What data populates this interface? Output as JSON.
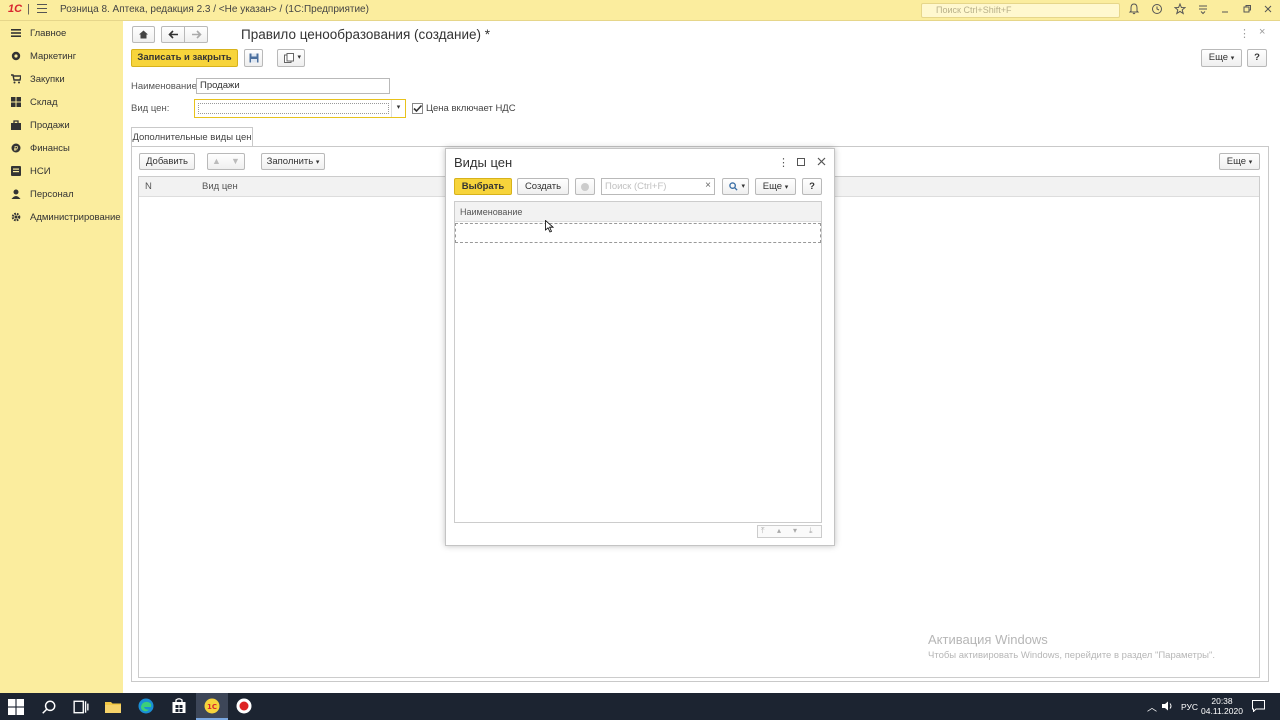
{
  "app": {
    "logo": "1С",
    "title": "Розница 8. Аптека, редакция 2.3 / <Не указан> /  (1С:Предприятие)",
    "search_placeholder": "Поиск Ctrl+Shift+F"
  },
  "sidebar": {
    "items": [
      {
        "label": "Главное",
        "icon": "menu-icon"
      },
      {
        "label": "Маркетинг",
        "icon": "marketing-icon"
      },
      {
        "label": "Закупки",
        "icon": "purchases-icon"
      },
      {
        "label": "Склад",
        "icon": "warehouse-icon"
      },
      {
        "label": "Продажи",
        "icon": "sales-icon"
      },
      {
        "label": "Финансы",
        "icon": "finance-icon"
      },
      {
        "label": "НСИ",
        "icon": "reference-icon"
      },
      {
        "label": "Персонал",
        "icon": "personnel-icon"
      },
      {
        "label": "Администрирование",
        "icon": "gear-icon"
      }
    ]
  },
  "form": {
    "title": "Правило ценообразования (создание) *",
    "save_close_label": "Записать и закрыть",
    "more_label": "Еще",
    "help_label": "?",
    "name_label": "Наименование:",
    "name_value": "Продажи",
    "price_type_label": "Вид цен:",
    "price_type_value": "",
    "vat_checkbox_label": "Цена включает НДС",
    "vat_checked": true,
    "tab_label": "Дополнительные виды цен",
    "add_label": "Добавить",
    "fill_label": "Заполнить",
    "table_more_label": "Еще",
    "columns": [
      "N",
      "Вид цен"
    ]
  },
  "dialog": {
    "title": "Виды цен",
    "select_label": "Выбрать",
    "create_label": "Создать",
    "search_placeholder": "Поиск (Ctrl+F)",
    "clear_label": "×",
    "more_label": "Еще",
    "help_label": "?",
    "column_header": "Наименование"
  },
  "watermark": {
    "title": "Активация Windows",
    "text": "Чтобы активировать Windows, перейдите в раздел \"Параметры\"."
  },
  "taskbar": {
    "lang": "РУС",
    "time": "20:38",
    "date": "04.11.2020"
  },
  "colors": {
    "accent_yellow": "#f7d43b",
    "panel_yellow": "#fbed9e",
    "taskbar": "#1c2431"
  }
}
